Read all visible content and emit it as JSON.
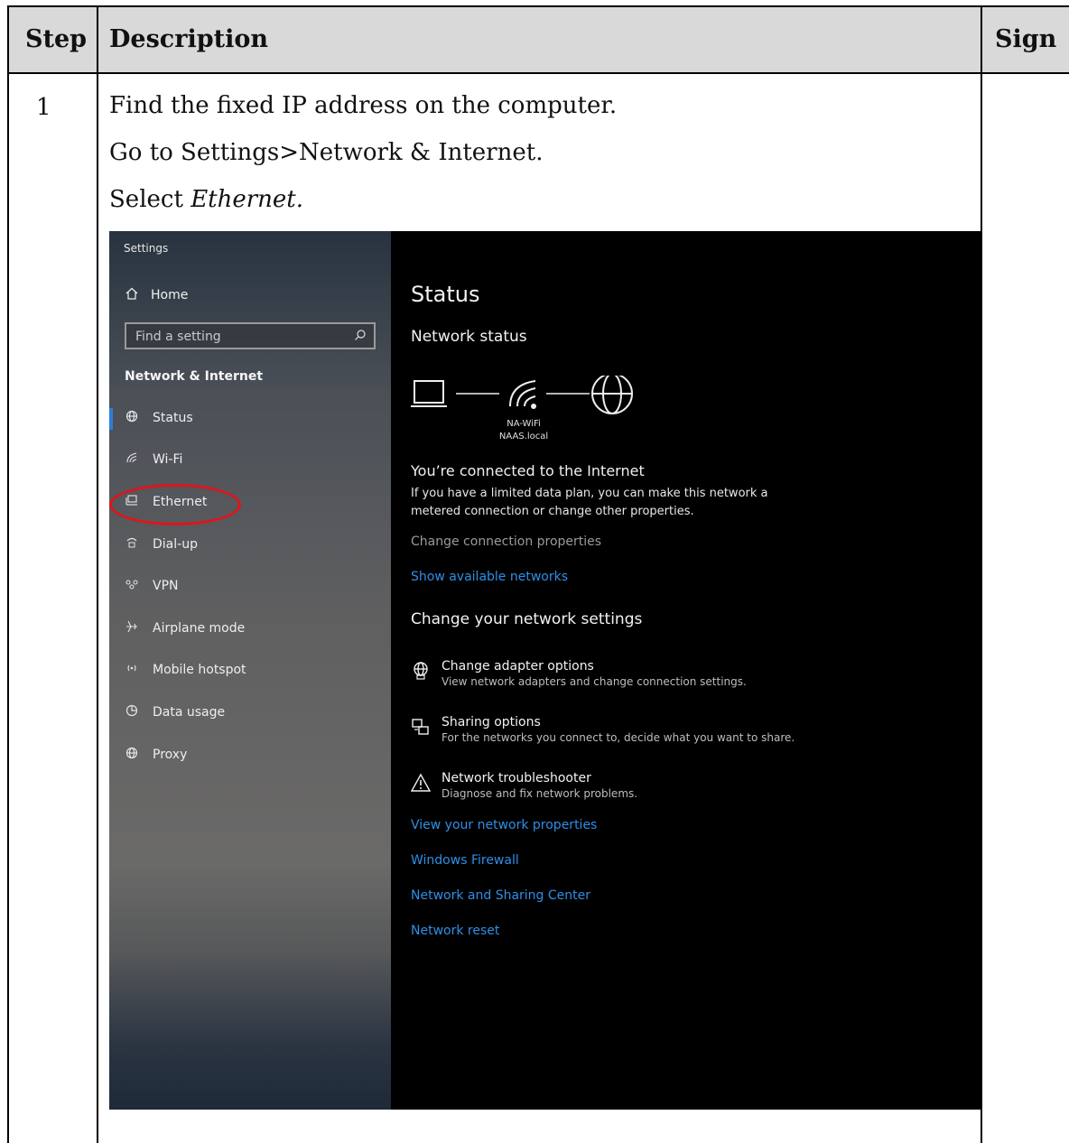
{
  "table": {
    "header": {
      "step": "Step",
      "description": "Description",
      "sign": "Sign"
    },
    "row": {
      "step_number": "1",
      "lines": [
        "Find the fixed IP address on the computer.",
        "Go to Settings>Network & Internet."
      ],
      "select_prefix": "Select ",
      "select_italic": "Ethernet."
    }
  },
  "settings": {
    "window_title": "Settings",
    "home": "Home",
    "search_placeholder": "Find a setting",
    "section": "Network & Internet",
    "nav": [
      {
        "label": "Status",
        "icon": "globe-grid-icon"
      },
      {
        "label": "Wi-Fi",
        "icon": "wifi-icon"
      },
      {
        "label": "Ethernet",
        "icon": "ethernet-icon"
      },
      {
        "label": "Dial-up",
        "icon": "dialup-icon"
      },
      {
        "label": "VPN",
        "icon": "vpn-icon"
      },
      {
        "label": "Airplane mode",
        "icon": "airplane-icon"
      },
      {
        "label": "Mobile hotspot",
        "icon": "hotspot-icon"
      },
      {
        "label": "Data usage",
        "icon": "data-usage-icon"
      },
      {
        "label": "Proxy",
        "icon": "globe-icon"
      }
    ],
    "main": {
      "title": "Status",
      "network_status": "Network status",
      "network_name": "NA-WiFi",
      "network_domain": "NAAS.local",
      "connected_heading": "You’re connected to the Internet",
      "connected_desc": "If you have a limited data plan, you can make this network a metered connection or change other properties.",
      "change_props": "Change connection properties",
      "show_networks": "Show available networks",
      "change_settings": "Change your network settings",
      "options": [
        {
          "title": "Change adapter options",
          "desc": "View network adapters and change connection settings.",
          "icon": "adapter-icon"
        },
        {
          "title": "Sharing options",
          "desc": "For the networks you connect to, decide what you want to share.",
          "icon": "sharing-icon"
        },
        {
          "title": "Network troubleshooter",
          "desc": "Diagnose and fix network problems.",
          "icon": "warning-icon"
        }
      ],
      "links": [
        "View your network properties",
        "Windows Firewall",
        "Network and Sharing Center",
        "Network reset"
      ]
    },
    "colors": {
      "accent": "#2b7ed6",
      "link": "#2f8fe6",
      "highlight": "#e0141c"
    }
  }
}
